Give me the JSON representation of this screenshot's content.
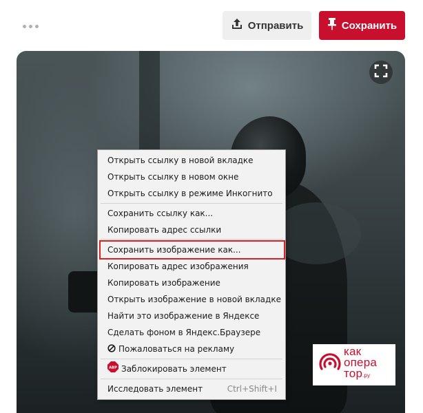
{
  "toolbar": {
    "more_icon": "more-dots-icon",
    "send_label": "Отправить",
    "send_icon": "share-upload-icon",
    "save_label": "Сохранить",
    "save_icon": "pin-icon",
    "save_color": "#c8102e"
  },
  "image": {
    "expand_icon": "fullscreen-expand-icon"
  },
  "context_menu": {
    "items": [
      {
        "label": "Открыть ссылку в новой вкладке"
      },
      {
        "label": "Открыть ссылку в новом окне"
      },
      {
        "label": "Открыть ссылку в режиме Инкогнито"
      },
      {
        "label": "Сохранить ссылку как..."
      },
      {
        "label": "Копировать адрес ссылки"
      },
      {
        "label": "Сохранить изображение как...",
        "highlighted": true
      },
      {
        "label": "Копировать адрес изображения"
      },
      {
        "label": "Копировать изображение"
      },
      {
        "label": "Открыть изображение в новой вкладке"
      },
      {
        "label": "Найти это изображение в Яндексе"
      },
      {
        "label": "Сделать фоном в Яндекс.Браузере"
      },
      {
        "label": "Пожаловаться на рекламу",
        "icon": "block-icon"
      },
      {
        "label": "Заблокировать элемент",
        "icon": "adblock-icon",
        "icon_text": "ABP"
      },
      {
        "label": "Исследовать элемент",
        "shortcut": "Ctrl+Shift+I"
      }
    ],
    "highlight_color": "#e02020"
  },
  "watermark": {
    "line1": "как",
    "line2": "опера",
    "line3": "тор",
    "suffix": ".ру",
    "color": "#c8102e"
  }
}
